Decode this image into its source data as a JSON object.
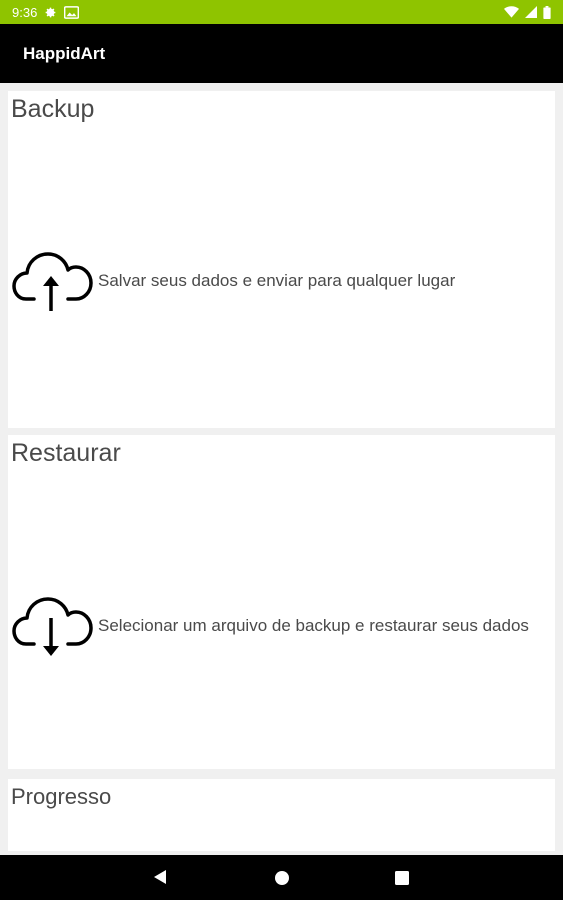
{
  "status_bar": {
    "time": "9:36",
    "icons": [
      "settings-icon",
      "photo-icon",
      "wifi-icon",
      "signal-icon",
      "battery-icon"
    ],
    "color": "#8fc400"
  },
  "app_bar": {
    "title": "HappidArt"
  },
  "cards": {
    "backup": {
      "title": "Backup",
      "description": "Salvar seus dados e enviar para qualquer lugar",
      "icon": "cloud-upload-icon"
    },
    "restore": {
      "title": "Restaurar",
      "description": "Selecionar um arquivo de backup e restaurar seus dados",
      "icon": "cloud-download-icon"
    },
    "progress": {
      "title": "Progresso"
    }
  },
  "nav_bar": {
    "icons": [
      "back-icon",
      "home-icon",
      "recents-icon"
    ]
  }
}
